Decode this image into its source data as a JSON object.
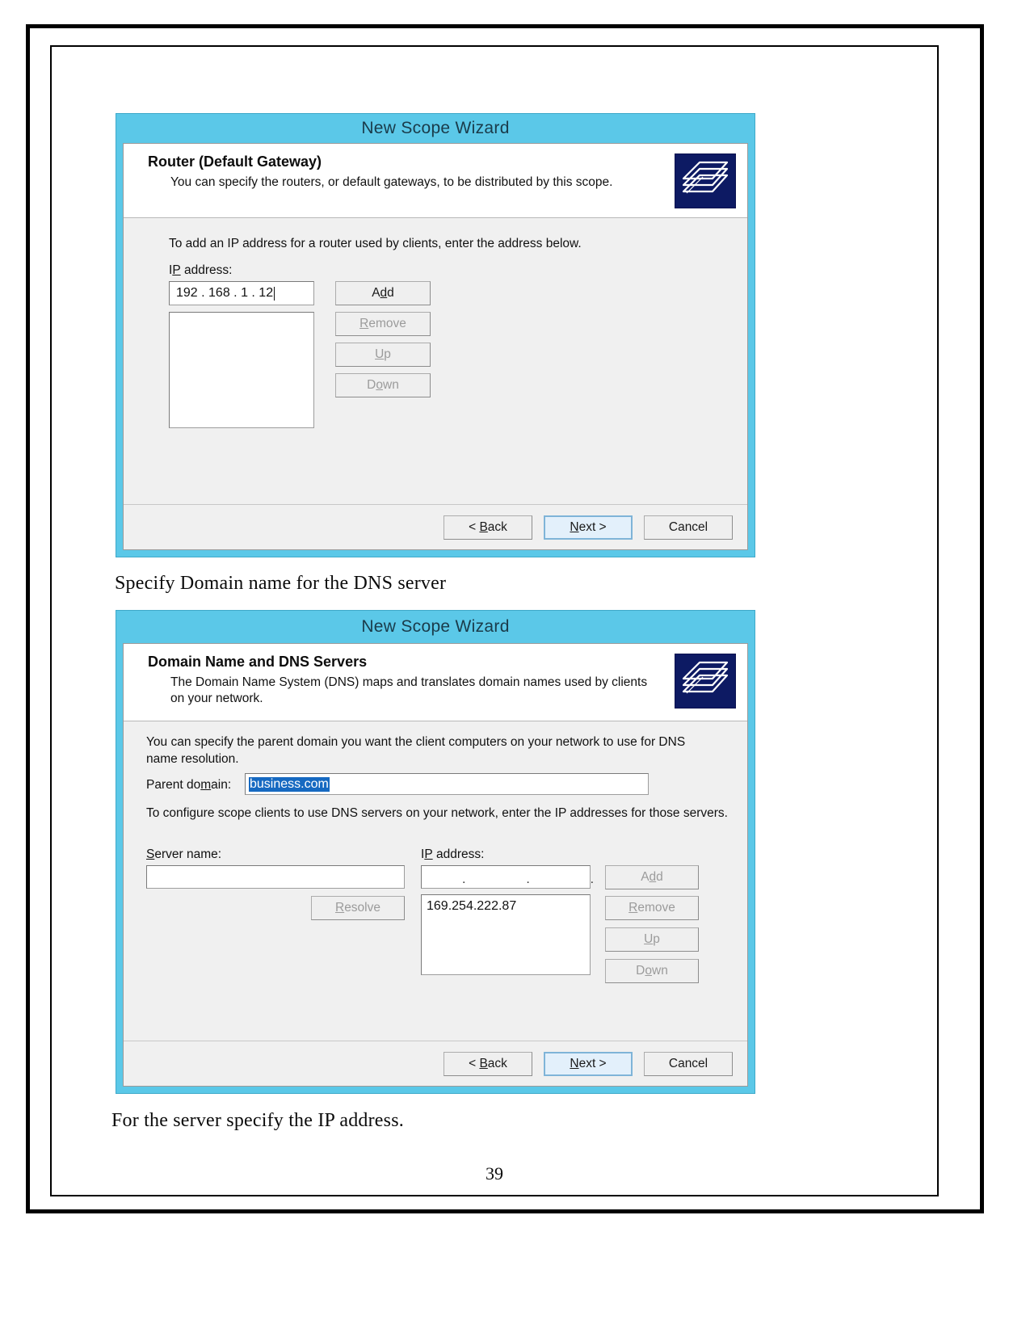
{
  "document": {
    "page_number": "39",
    "paragraph_1": "Specify Domain name for the DNS server",
    "paragraph_2": "For the server specify the IP address."
  },
  "dialog_router": {
    "title": "New Scope Wizard",
    "header_title": "Router (Default Gateway)",
    "header_desc": "You can specify the routers, or default gateways, to be distributed by this scope.",
    "icon": "folders-stack-icon",
    "instruction": "To add an IP address for a router used by clients, enter the address below.",
    "ip_label": "IP address:",
    "ip_value": "192 . 168 .  1  . 12",
    "list_items": [],
    "buttons": {
      "add": "Add",
      "remove": "Remove",
      "up": "Up",
      "down": "Down"
    },
    "nav": {
      "back": "< Back",
      "next": "Next >",
      "cancel": "Cancel"
    }
  },
  "dialog_dns": {
    "title": "New Scope Wizard",
    "header_title": "Domain Name and DNS Servers",
    "header_desc": "The Domain Name System (DNS) maps and translates domain names used by clients on your network.",
    "icon": "folders-stack-icon",
    "instruction_1": "You can specify the parent domain you want the client computers on your network to use for DNS name resolution.",
    "parent_domain_label": "Parent domain:",
    "parent_domain_value": "business.com",
    "instruction_2": "To configure scope clients to use DNS servers on your network, enter the IP addresses for those servers.",
    "server_name_label": "Server name:",
    "server_name_value": "",
    "ip_label": "IP address:",
    "ip_value": ".            .            .",
    "list_items": [
      "169.254.222.87"
    ],
    "buttons": {
      "resolve": "Resolve",
      "add": "Add",
      "remove": "Remove",
      "up": "Up",
      "down": "Down"
    },
    "nav": {
      "back": "< Back",
      "next": "Next >",
      "cancel": "Cancel"
    }
  },
  "colors": {
    "wizard_frame": "#5bc8e8",
    "dialog_face": "#f0f0f0",
    "selection_blue": "#1669c1",
    "icon_navy": "#0d1a63"
  }
}
